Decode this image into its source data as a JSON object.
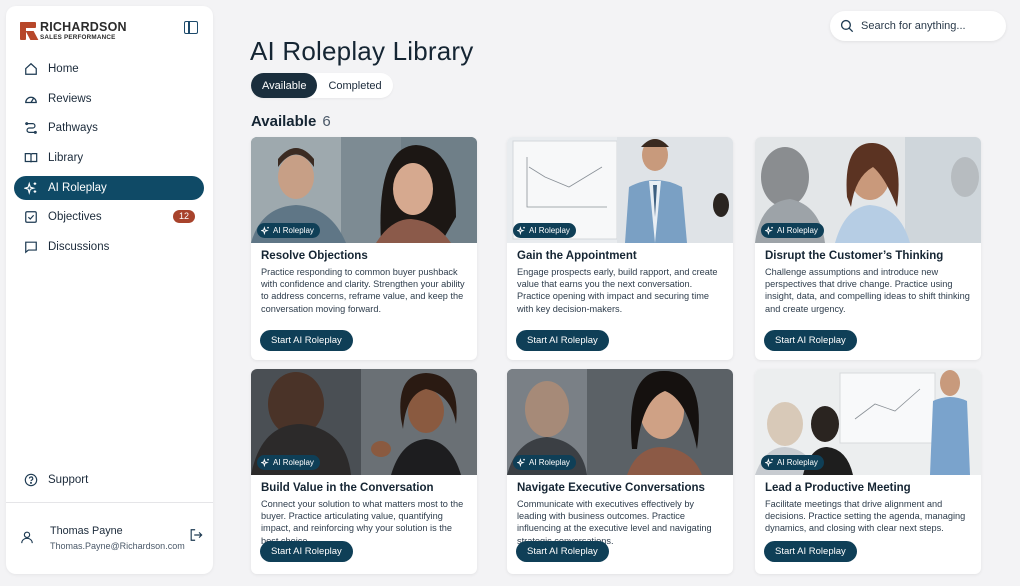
{
  "brand": {
    "name": "RICHARDSON",
    "sub": "SALES PERFORMANCE"
  },
  "sidebar": {
    "items": [
      {
        "label": "Home",
        "icon": "home-icon"
      },
      {
        "label": "Reviews",
        "icon": "reviews-icon"
      },
      {
        "label": "Pathways",
        "icon": "pathways-icon"
      },
      {
        "label": "Library",
        "icon": "book-icon"
      },
      {
        "label": "AI Roleplay",
        "icon": "sparkle-icon",
        "active": true
      },
      {
        "label": "Objectives",
        "icon": "checkbox-icon",
        "badge": "12"
      },
      {
        "label": "Discussions",
        "icon": "chat-icon"
      }
    ],
    "support": "Support",
    "user": {
      "name": "Thomas Payne",
      "email": "Thomas.Payne@Richardson.com"
    }
  },
  "search": {
    "placeholder": "Search for anything..."
  },
  "page": {
    "title": "AI Roleplay Library",
    "tabs": [
      {
        "label": "Available",
        "active": true
      },
      {
        "label": "Completed"
      }
    ],
    "section": {
      "title": "Available",
      "count": "6"
    }
  },
  "cards": [
    {
      "chip": "AI Roleplay",
      "title": "Resolve Objections",
      "description": "Practice responding to common buyer pushback with confidence and clarity. Strengthen your ability to address concerns, reframe value, and keep the conversation moving forward.",
      "button": "Start AI Roleplay"
    },
    {
      "chip": "AI Roleplay",
      "title": "Gain the Appointment",
      "description": "Engage prospects early, build rapport, and create value that earns you the next conversation. Practice opening with impact and securing time with key decision-makers.",
      "button": "Start AI Roleplay"
    },
    {
      "chip": "AI Roleplay",
      "title": "Disrupt the Customer’s Thinking",
      "description": "Challenge assumptions and introduce new perspectives that drive change. Practice using insight, data, and compelling ideas to shift thinking and create urgency.",
      "button": "Start AI Roleplay"
    },
    {
      "chip": "AI Roleplay",
      "title": "Build Value in the Conversation",
      "description": "Connect your solution to what matters most to the buyer. Practice articulating value, quantifying impact, and reinforcing why your solution is the best choice.",
      "button": "Start AI Roleplay"
    },
    {
      "chip": "AI Roleplay",
      "title": "Navigate Executive Conversations",
      "description": "Communicate with executives effectively by leading with business outcomes. Practice influencing at the executive level and navigating strategic conversations.",
      "button": "Start AI Roleplay"
    },
    {
      "chip": "AI Roleplay",
      "title": "Lead a Productive Meeting",
      "description": "Facilitate meetings that drive alignment and decisions. Practice setting the agenda, managing dynamics, and closing with clear next steps.",
      "button": "Start AI Roleplay"
    }
  ],
  "colors": {
    "primary": "#0f4a66",
    "brand_red": "#b7472a",
    "badge": "#a8432c"
  }
}
